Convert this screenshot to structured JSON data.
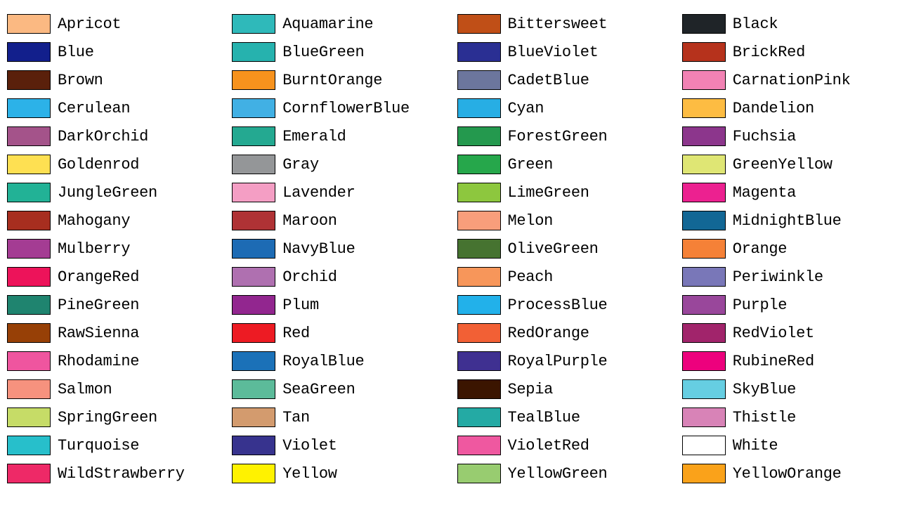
{
  "colors": [
    {
      "name": "Apricot",
      "hex": "#FBB982"
    },
    {
      "name": "Blue",
      "hex": "#121F8C"
    },
    {
      "name": "Brown",
      "hex": "#5A200B"
    },
    {
      "name": "Cerulean",
      "hex": "#2CB2E8"
    },
    {
      "name": "DarkOrchid",
      "hex": "#A4538A"
    },
    {
      "name": "Goldenrod",
      "hex": "#FEE052"
    },
    {
      "name": "JungleGreen",
      "hex": "#22B296"
    },
    {
      "name": "Mahogany",
      "hex": "#A72E1F"
    },
    {
      "name": "Mulberry",
      "hex": "#A43C93"
    },
    {
      "name": "OrangeRed",
      "hex": "#ED135A"
    },
    {
      "name": "PineGreen",
      "hex": "#1F846F"
    },
    {
      "name": "RawSienna",
      "hex": "#974006"
    },
    {
      "name": "Rhodamine",
      "hex": "#EF559F"
    },
    {
      "name": "Salmon",
      "hex": "#F6927E"
    },
    {
      "name": "SpringGreen",
      "hex": "#C6DC67"
    },
    {
      "name": "Turquoise",
      "hex": "#27BFCB"
    },
    {
      "name": "WildStrawberry",
      "hex": "#EE2967"
    },
    {
      "name": "Aquamarine",
      "hex": "#2FB9BA"
    },
    {
      "name": "BlueGreen",
      "hex": "#26B2AE"
    },
    {
      "name": "BurntOrange",
      "hex": "#F7921D"
    },
    {
      "name": "CornflowerBlue",
      "hex": "#41B0E4"
    },
    {
      "name": "Emerald",
      "hex": "#24A991"
    },
    {
      "name": "Gray",
      "hex": "#949698"
    },
    {
      "name": "Lavender",
      "hex": "#F49EC4"
    },
    {
      "name": "Maroon",
      "hex": "#AF3235"
    },
    {
      "name": "NavyBlue",
      "hex": "#1D6BB4"
    },
    {
      "name": "Orchid",
      "hex": "#AF70B0"
    },
    {
      "name": "Plum",
      "hex": "#92268F"
    },
    {
      "name": "Red",
      "hex": "#ED1B23"
    },
    {
      "name": "RoyalBlue",
      "hex": "#1B71B8"
    },
    {
      "name": "SeaGreen",
      "hex": "#5CBB9A"
    },
    {
      "name": "Tan",
      "hex": "#D39B6E"
    },
    {
      "name": "Violet",
      "hex": "#37338E"
    },
    {
      "name": "Yellow",
      "hex": "#FFF200"
    },
    {
      "name": "Bittersweet",
      "hex": "#C04F17"
    },
    {
      "name": "BlueViolet",
      "hex": "#2A2F93"
    },
    {
      "name": "CadetBlue",
      "hex": "#6C769D"
    },
    {
      "name": "Cyan",
      "hex": "#27AEE4"
    },
    {
      "name": "ForestGreen",
      "hex": "#24994E"
    },
    {
      "name": "Green",
      "hex": "#26A74B"
    },
    {
      "name": "LimeGreen",
      "hex": "#8DC73E"
    },
    {
      "name": "Melon",
      "hex": "#F89E7B"
    },
    {
      "name": "OliveGreen",
      "hex": "#467330"
    },
    {
      "name": "Peach",
      "hex": "#F7965A"
    },
    {
      "name": "ProcessBlue",
      "hex": "#22B1EA"
    },
    {
      "name": "RedOrange",
      "hex": "#F26035"
    },
    {
      "name": "RoyalPurple",
      "hex": "#3F3091"
    },
    {
      "name": "Sepia",
      "hex": "#3B1500"
    },
    {
      "name": "TealBlue",
      "hex": "#24AAA4"
    },
    {
      "name": "VioletRed",
      "hex": "#EF58A0"
    },
    {
      "name": "YellowGreen",
      "hex": "#98CC70"
    },
    {
      "name": "Black",
      "hex": "#1F2428"
    },
    {
      "name": "BrickRed",
      "hex": "#B6321C"
    },
    {
      "name": "CarnationPink",
      "hex": "#F282B4"
    },
    {
      "name": "Dandelion",
      "hex": "#FDBC42"
    },
    {
      "name": "Fuchsia",
      "hex": "#8C368C"
    },
    {
      "name": "GreenYellow",
      "hex": "#DFE674"
    },
    {
      "name": "Magenta",
      "hex": "#EC2190"
    },
    {
      "name": "MidnightBlue",
      "hex": "#126795"
    },
    {
      "name": "Orange",
      "hex": "#F58137"
    },
    {
      "name": "Periwinkle",
      "hex": "#7977B8"
    },
    {
      "name": "Purple",
      "hex": "#99479B"
    },
    {
      "name": "RedViolet",
      "hex": "#A1246B"
    },
    {
      "name": "RubineRed",
      "hex": "#ED017D"
    },
    {
      "name": "SkyBlue",
      "hex": "#66CEE2"
    },
    {
      "name": "Thistle",
      "hex": "#D883B7"
    },
    {
      "name": "White",
      "hex": "#FFFFFF"
    },
    {
      "name": "YellowOrange",
      "hex": "#FAA21A"
    }
  ]
}
